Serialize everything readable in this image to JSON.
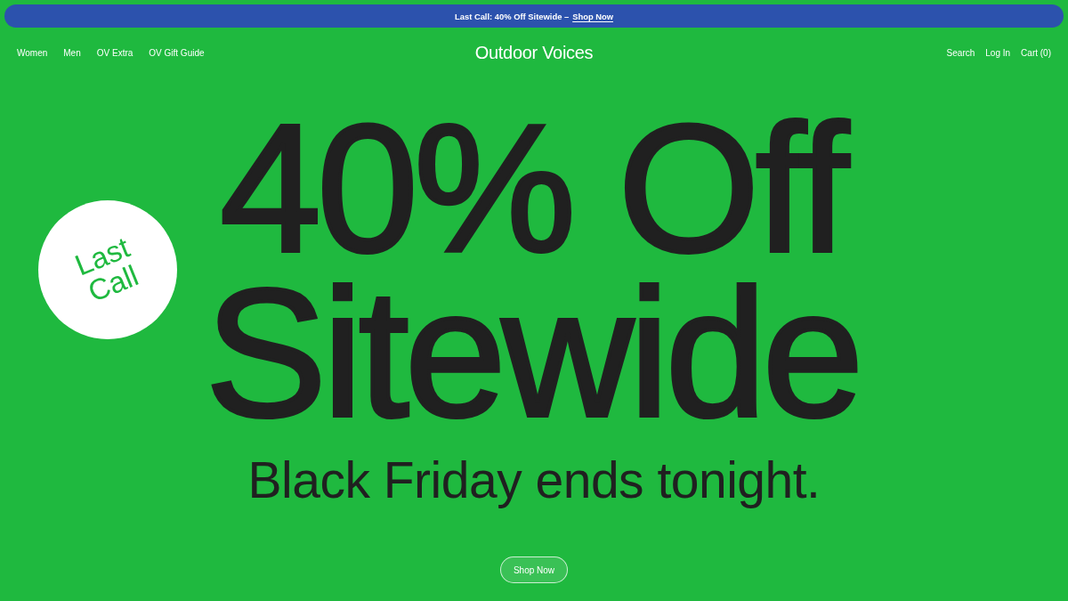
{
  "announcement": {
    "text": "Last Call: 40% Off Sitewide –",
    "link": "Shop Now"
  },
  "nav": {
    "left": [
      "Women",
      "Men",
      "OV Extra",
      "OV Gift Guide"
    ],
    "logo": "Outdoor Voices",
    "right": [
      "Search",
      "Log In",
      "Cart (0)"
    ]
  },
  "hero": {
    "badge": "Last Call",
    "headline": [
      "40% Off",
      "Sitewide"
    ],
    "subheadline": "Black Friday ends tonight.",
    "button": "Shop Now"
  }
}
